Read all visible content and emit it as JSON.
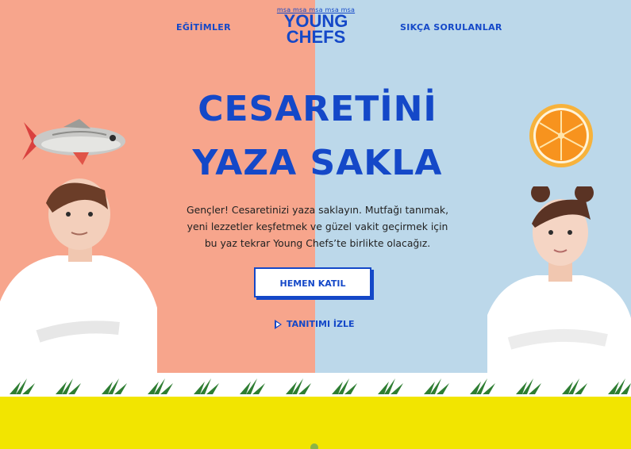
{
  "nav": {
    "left_link": "EĞİTİMLER",
    "right_link": "SIKÇA SORULANLAR"
  },
  "logo": {
    "brand_repeat": "msa msa msa msa msa",
    "line1": "YOUNG",
    "line2": "CHEFS"
  },
  "hero": {
    "title_line1": "CESARETİNİ",
    "title_line2": "YAZA SAKLA",
    "description": "Gençler! Cesaretinizi yaza saklayın. Mutfağı tanımak, yeni lezzetler keşfetmek ve güzel vakit geçirmek için bu yaz tekrar Young Chefs’te birlikte olacağız.",
    "cta_label": "HEMEN KATIL",
    "video_link": "TANITIMI İZLE"
  },
  "colors": {
    "left_panel": "#f7a58c",
    "right_panel": "#bcd8ea",
    "brand_blue": "#1448c8",
    "bottom_band": "#f2e500"
  },
  "icons": {
    "play": "play-icon",
    "fish": "fish-icon",
    "orange": "orange-slice-icon",
    "herb": "herb-sprig-icon"
  }
}
